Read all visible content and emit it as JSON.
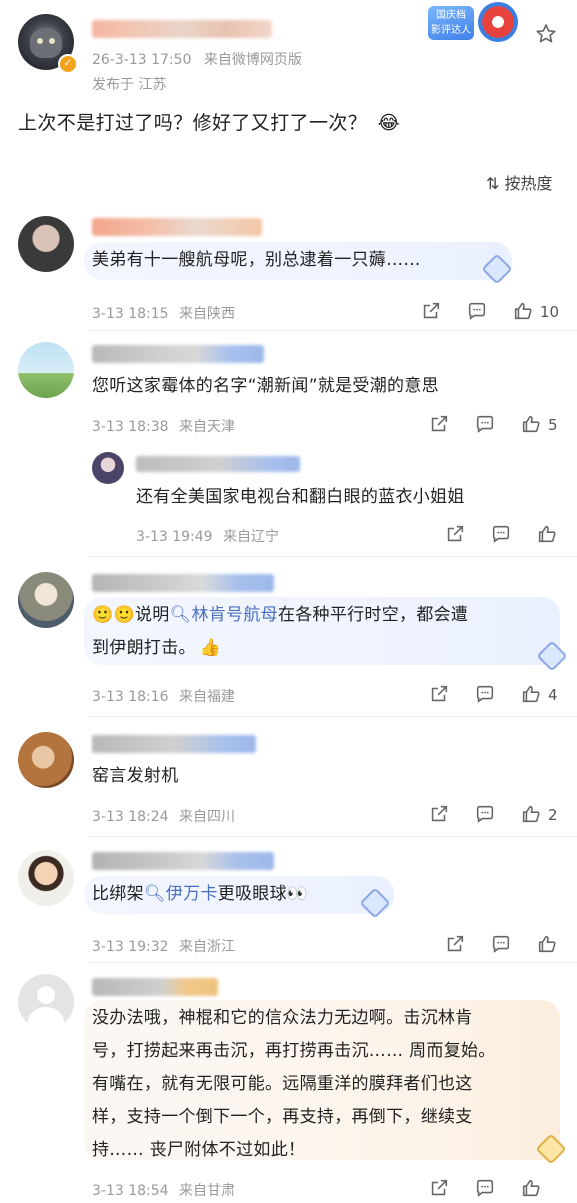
{
  "post": {
    "timestamp": "26-3-13 17:50",
    "source": "来自微博网页版",
    "location": "发布于 江苏",
    "text": "上次不是打过了吗？修好了又打了一次？",
    "emoji": "😂",
    "badge": [
      "国庆档",
      "影评达人"
    ]
  },
  "sort": {
    "label": "按热度"
  },
  "comments": [
    {
      "text": "美弟有十一艘航母呢，别总逮着一只薅……",
      "time": "3-13 18:15",
      "location": "来自陕西",
      "likes": "10"
    },
    {
      "text": "您听这家霉体的名字“潮新闻”就是受潮的意思",
      "time": "3-13 18:38",
      "location": "来自天津",
      "likes": "5",
      "reply": {
        "text": "还有全美国家电视台和翻白眼的蓝衣小姐姐",
        "time": "3-13 19:49",
        "location": "来自辽宁",
        "likes": ""
      }
    },
    {
      "prefix": "说明",
      "link": "林肯号航母",
      "line1_rest": "在各种平行时空，都会遭",
      "line2": "到伊朗打击。",
      "time": "3-13 18:16",
      "location": "来自福建",
      "likes": "4"
    },
    {
      "text": "窑言发射机",
      "time": "3-13 18:24",
      "location": "来自四川",
      "likes": "2"
    },
    {
      "prefix": "比绑架",
      "link": "伊万卡",
      "suffix": "更吸眼球",
      "time": "3-13 19:32",
      "location": "来自浙江",
      "likes": ""
    },
    {
      "lines": [
        "没办法哦，神棍和它的信众法力无边啊。击沉林肯",
        "号，打捞起来再击沉，再打捞再击沉…… 周而复始。",
        "有嘴在，就有无限可能。远隔重洋的膜拜者们也这",
        "样，支持一个倒下一个，再支持，再倒下，继续支",
        "持…… 丧尸附体不过如此！"
      ],
      "time": "3-13 18:54",
      "location": "来自甘肃",
      "likes": ""
    }
  ]
}
